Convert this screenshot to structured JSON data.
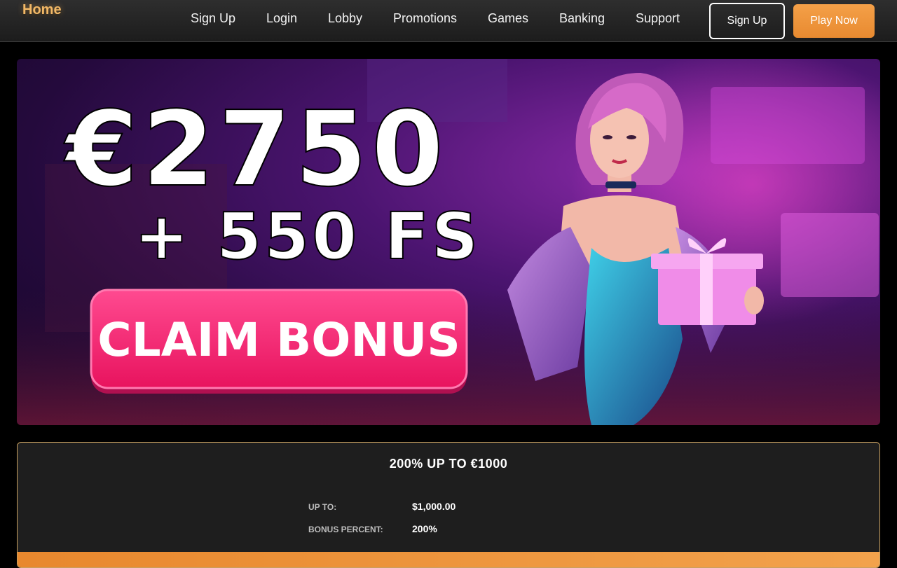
{
  "header": {
    "logo": "Home",
    "nav": [
      "Sign Up",
      "Login",
      "Lobby",
      "Promotions",
      "Games",
      "Banking",
      "Support"
    ],
    "signup_button": "Sign Up",
    "play_button": "Play Now"
  },
  "banner": {
    "amount": "€2750",
    "free_spins": "+ 550 FS",
    "cta": "CLAIM BONUS"
  },
  "bonus": {
    "title": "200% UP TO €1000",
    "rows": [
      {
        "label": "UP TO:",
        "value": "$1,000.00"
      },
      {
        "label": "BONUS PERCENT:",
        "value": "200%"
      }
    ]
  },
  "colors": {
    "accent": "#f2b866",
    "button_orange": "#ee9440",
    "cta_pink": "#ff2d7a",
    "card_border": "#c8a060"
  }
}
